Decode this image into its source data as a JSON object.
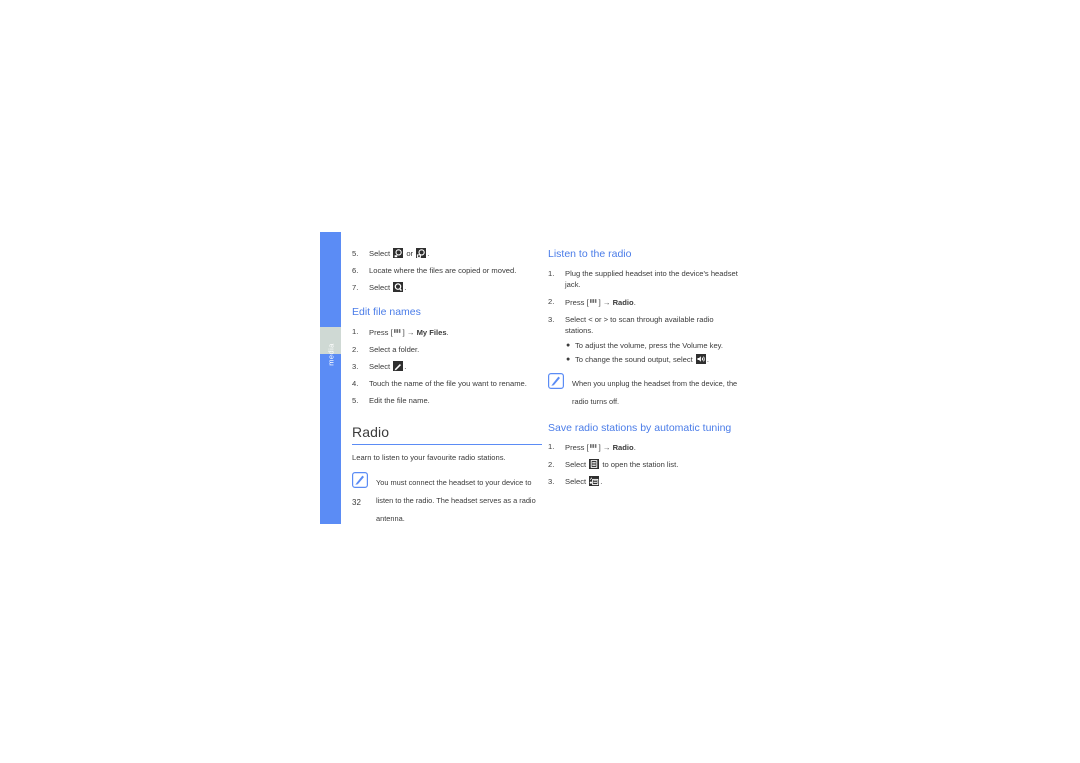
{
  "sidebar": {
    "label": "media",
    "color": "#5b8cf5",
    "gap_color": "#cfd9d4"
  },
  "page": {
    "number": "32",
    "accent_color": "#4a7ce8",
    "text_color": "#3b3b3b"
  },
  "left_column": {
    "continued_steps": [
      {
        "num": "5.",
        "pre": "Select ",
        "mid": " or ",
        "post": "."
      },
      {
        "num": "6.",
        "text": "Locate where the files are copied or moved."
      },
      {
        "num": "7.",
        "pre": "Select ",
        "post": "."
      }
    ],
    "edit_file_names": {
      "heading": "Edit file names",
      "steps": [
        {
          "num": "1.",
          "pre": "Press [",
          "post": "] → ",
          "bold": "My Files",
          "tail": "."
        },
        {
          "num": "2.",
          "text": "Select a folder."
        },
        {
          "num": "3.",
          "pre": "Select ",
          "post": "."
        },
        {
          "num": "4.",
          "text": "Touch the name of the file you want to rename."
        },
        {
          "num": "5.",
          "text": "Edit the file name."
        }
      ]
    },
    "radio_section": {
      "heading": "Radio",
      "lead": "Learn to listen to your favourite radio stations.",
      "note": "You must connect the headset to your device to listen to the radio. The headset serves as a radio antenna."
    }
  },
  "right_column": {
    "listen": {
      "heading": "Listen to the radio",
      "steps": [
        {
          "num": "1.",
          "text": "Plug the supplied headset into the device's headset jack."
        },
        {
          "num": "2.",
          "pre": "Press [",
          "post": "] → ",
          "bold": "Radio",
          "tail": "."
        },
        {
          "num": "3.",
          "text": "Select < or > to scan through available radio stations."
        }
      ],
      "bullets": [
        {
          "text": "To adjust the volume, press the Volume key."
        },
        {
          "pre": "To change the sound output, select ",
          "post": "."
        }
      ],
      "note": "When you unplug the headset from the device, the radio turns off."
    },
    "save_stations": {
      "heading": "Save radio stations by automatic tuning",
      "steps": [
        {
          "num": "1.",
          "pre": "Press [",
          "post": "] → ",
          "bold": "Radio",
          "tail": "."
        },
        {
          "num": "2.",
          "pre": "Select ",
          "post": " to open the station list."
        },
        {
          "num": "3.",
          "pre": "Select ",
          "post": "."
        }
      ]
    }
  },
  "icons": {
    "copy": "copy-icon",
    "move": "move-icon",
    "confirm": "confirm-icon",
    "menu_key": "menu-key-icon",
    "rename": "pencil-icon",
    "sound_output": "speaker-icon",
    "station_list": "list-icon",
    "auto_tune": "auto-tune-icon",
    "note": "note-icon"
  }
}
